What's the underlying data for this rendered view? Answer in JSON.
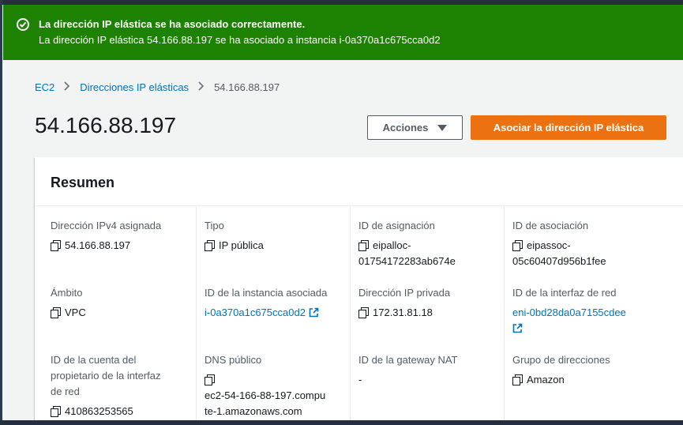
{
  "flash": {
    "title": "La dirección IP elástica se ha asociado correctamente.",
    "message": "La dirección IP elástica 54.166.88.197 se ha asociado a instancia i-0a370a1c675cca0d2",
    "color": "#1d8102"
  },
  "breadcrumb": {
    "items": [
      "EC2",
      "Direcciones IP elásticas"
    ],
    "current": "54.166.88.197"
  },
  "page": {
    "title": "54.166.88.197"
  },
  "buttons": {
    "actions": "Acciones",
    "associate": "Asociar la dirección IP elástica",
    "primary_color": "#ec7211"
  },
  "summary": {
    "title": "Resumen",
    "fields": {
      "ipv4_label": "Dirección IPv4 asignada",
      "ipv4_value": "54.166.88.197",
      "type_label": "Tipo",
      "type_value": "IP pública",
      "alloc_label": "ID de asignación",
      "alloc_value_1": "eipalloc-",
      "alloc_value_2": "01754172283ab674e",
      "assoc_label": "ID de asociación",
      "assoc_value_1": "eipassoc-",
      "assoc_value_2": "05c60407d956b1fee",
      "scope_label": "Ámbito",
      "scope_value": "VPC",
      "instance_label": "ID de la instancia asociada",
      "instance_value": "i-0a370a1c675cca0d2",
      "private_ip_label": "Dirección IP privada",
      "private_ip_value": "172.31.81.18",
      "eni_label": "ID de la interfaz de red",
      "eni_value": "eni-0bd28da0a7155cdee",
      "owner_label_1": "ID de la cuenta del",
      "owner_label_2": "propietario de la interfaz",
      "owner_label_3": "de red",
      "owner_value": "410863253565",
      "dns_label": "DNS público",
      "dns_value_1": "ec2-54-166-88-197.compu",
      "dns_value_2": "te-1.amazonaws.com",
      "nat_label": "ID de la gateway NAT",
      "nat_value": "-",
      "pool_label": "Grupo de direcciones",
      "pool_value": "Amazon"
    }
  }
}
